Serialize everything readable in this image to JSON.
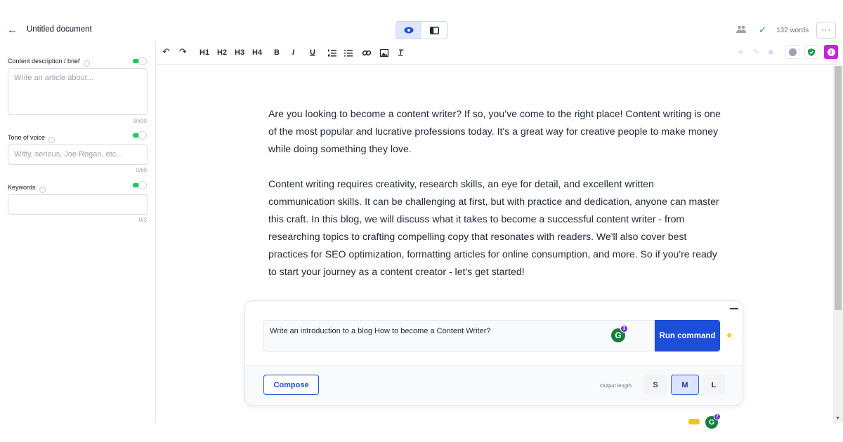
{
  "header": {
    "back_icon": "arrow-left-icon",
    "title": "Untitled document",
    "word_count": "132 words",
    "more_label": "···"
  },
  "sidebar": {
    "content": {
      "label": "Content description / brief",
      "placeholder": "Write an article about...",
      "counter": "0/600",
      "enabled": true
    },
    "tone": {
      "label": "Tone of voice",
      "placeholder": "Witty, serious, Joe Rogan, etc...",
      "counter": "0/60",
      "enabled": true
    },
    "keywords": {
      "label": "Keywords",
      "placeholder": "",
      "counter": "0/3",
      "enabled": true
    }
  },
  "toolbar": {
    "undo": "↶",
    "redo": "↷",
    "h1": "H1",
    "h2": "H2",
    "h3": "H3",
    "h4": "H4",
    "bold": "B",
    "italic": "I",
    "underline": "U",
    "ordered_list": "ordered-list-icon",
    "bullet_list": "bullet-list-icon",
    "link": "link-icon",
    "image": "image-icon",
    "clear_format": "clear-format-icon"
  },
  "editor": {
    "paragraphs": [
      "Are you looking to become a content writer? If so, you’ve come to the right place! Content writing is one of the most popular and lucrative professions today. It's a great way for creative people to make money while doing something they love.",
      "Content writing requires creativity, research skills, an eye for detail, and excellent written communication skills. It can be challenging at first, but with practice and dedication, anyone can master this craft. In this blog, we will discuss what it takes to become a successful content writer - from researching topics to crafting compelling copy that resonates with readers. We'll also cover best practices for SEO optimization, formatting articles for online consumption, and more. So if you're ready to start your journey as a content creator - let's get started!"
    ]
  },
  "command": {
    "prompt": "Write an introduction to a  blog How to become a Content Writer?",
    "grammarly_badge": "3",
    "run_label": "Run command",
    "compose_label": "Compose",
    "output_length_label": "Output length",
    "sizes": [
      "S",
      "M",
      "L"
    ],
    "selected_size": "M"
  },
  "floating": {
    "grammarly_badge": "2"
  },
  "colors": {
    "accent": "#1d4ed8",
    "toggle_on": "#22c55e",
    "check": "#16a34a",
    "pink_button": "#c026d3"
  }
}
